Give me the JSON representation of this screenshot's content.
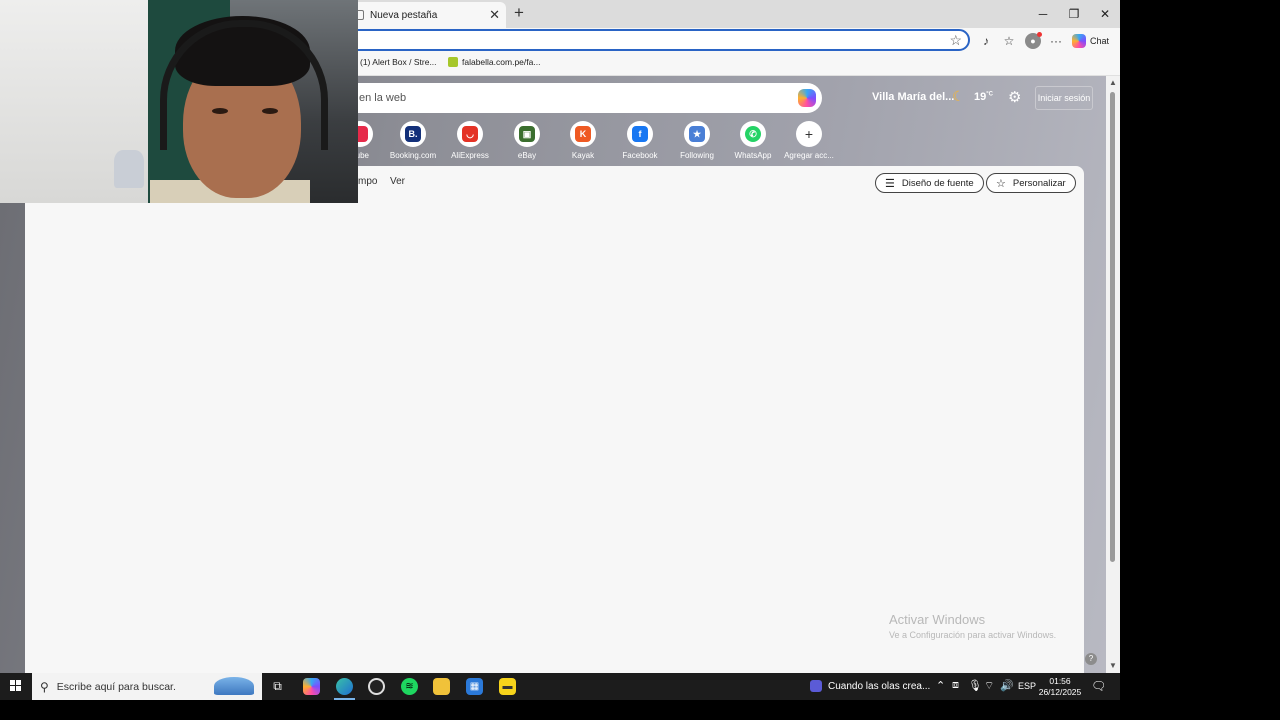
{
  "browser": {
    "tab_title": "Nueva pestaña",
    "tab_close": "✕",
    "new_tab": "+",
    "window_controls": {
      "minimize": "─",
      "maximize": "❐",
      "close": "✕"
    },
    "toolbar": {
      "chat_label": "Chat",
      "star_icon": "☆",
      "more": "···"
    },
    "favorites": [
      {
        "label": "(1) Alert Box / Stre...",
        "color": "#ffffff"
      },
      {
        "label": "falabella.com.pe/fa...",
        "color": "#a6c72a"
      }
    ]
  },
  "newtab": {
    "search_placeholder": "en la web",
    "weather": {
      "location": "Villa María del...",
      "temp": "19",
      "unit": "°C"
    },
    "signin_label": "Iniciar sesión",
    "quick_links": [
      {
        "label": "Tube",
        "icon": "youtube-icon",
        "letter": "",
        "color": "#e62a4a"
      },
      {
        "label": "Booking.com",
        "icon": "booking-icon",
        "letter": "B.",
        "color": "#13307a"
      },
      {
        "label": "AliExpress",
        "icon": "aliexpress-icon",
        "letter": "◡",
        "color": "#e43225"
      },
      {
        "label": "eBay",
        "icon": "ebay-icon",
        "letter": "▣",
        "color": "#3b6f2f"
      },
      {
        "label": "Kayak",
        "icon": "kayak-icon",
        "letter": "K",
        "color": "#ef5a23"
      },
      {
        "label": "Facebook",
        "icon": "facebook-icon",
        "letter": "f",
        "color": "#1877f2"
      },
      {
        "label": "Following",
        "icon": "following-icon",
        "letter": "★",
        "color": "#4a7fd6"
      },
      {
        "label": "WhatsApp",
        "icon": "whatsapp-icon",
        "letter": "✆",
        "color": "#25d366"
      },
      {
        "label": "Agregar acc...",
        "icon": "add-icon",
        "letter": "+",
        "color": "#ffffff"
      }
    ],
    "feed_tabs": [
      "mpo",
      "Ver"
    ],
    "font_design_label": "Diseño de fuente",
    "customize_label": "Personalizar",
    "activate_title": "Activar Windows",
    "activate_sub": "Ve a Configuración para activar Windows.",
    "help": "?"
  },
  "taskbar": {
    "search_placeholder": "Escribe aquí para buscar.",
    "media_title": "Cuando las olas crea...",
    "language": "ESP",
    "time": "01:56",
    "date": "26/12/2025"
  }
}
